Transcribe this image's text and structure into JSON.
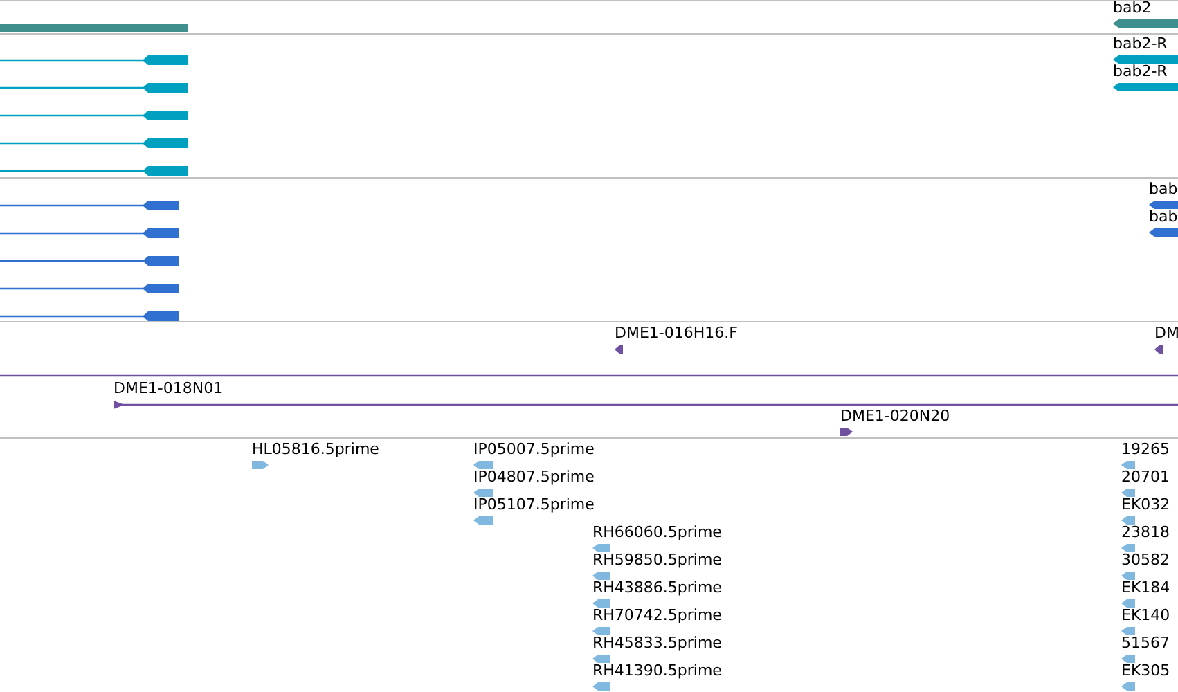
{
  "tracks": [
    {
      "color": "#3f8f8f",
      "features": [
        {
          "kind": "box"
        },
        {
          "kind": "box",
          "label": "bab2",
          "forward": false
        }
      ]
    },
    {
      "color": "#00a0c0",
      "features": [
        {
          "kind": "spliced",
          "forward": false
        },
        {
          "kind": "spliced",
          "forward": false
        },
        {
          "kind": "spliced",
          "forward": false
        },
        {
          "kind": "spliced",
          "forward": false
        },
        {
          "kind": "spliced",
          "forward": false
        },
        {
          "kind": "box",
          "label": "bab2-R",
          "forward": false
        },
        {
          "kind": "box",
          "label": "bab2-R",
          "forward": false
        }
      ]
    },
    {
      "color": "#3070d0",
      "features": [
        {
          "kind": "spliced",
          "forward": false
        },
        {
          "kind": "spliced",
          "forward": false
        },
        {
          "kind": "spliced",
          "forward": false
        },
        {
          "kind": "spliced",
          "forward": false
        },
        {
          "kind": "spliced",
          "forward": false
        },
        {
          "kind": "box",
          "label": "bab",
          "forward": false
        },
        {
          "kind": "box",
          "label": "bab",
          "forward": false
        }
      ]
    },
    {
      "color": "#7050a0",
      "features": [
        {
          "kind": "box",
          "label": "DME1-016H16.F",
          "forward": false
        },
        {
          "kind": "box",
          "label": "DM",
          "forward": false
        },
        {
          "kind": "span"
        },
        {
          "kind": "span",
          "label": "DME1-018N01",
          "forward": true
        },
        {
          "kind": "box",
          "label": "DME1-020N20",
          "forward": true
        }
      ]
    },
    {
      "color": "#80b8e0",
      "features": [
        {
          "kind": "box",
          "label": "HL05816.5prime",
          "forward": true
        },
        {
          "kind": "box",
          "label": "IP05007.5prime",
          "forward": false
        },
        {
          "kind": "box",
          "label": "IP04807.5prime",
          "forward": false
        },
        {
          "kind": "box",
          "label": "IP05107.5prime",
          "forward": false
        },
        {
          "kind": "box",
          "label": "RH66060.5prime",
          "forward": false
        },
        {
          "kind": "box",
          "label": "RH59850.5prime",
          "forward": false
        },
        {
          "kind": "box",
          "label": "RH43886.5prime",
          "forward": false
        },
        {
          "kind": "box",
          "label": "RH70742.5prime",
          "forward": false
        },
        {
          "kind": "box",
          "label": "RH45833.5prime",
          "forward": false
        },
        {
          "kind": "box",
          "label": "RH41390.5prime",
          "forward": false
        },
        {
          "kind": "box",
          "label": "19265",
          "forward": false
        },
        {
          "kind": "box",
          "label": "20701",
          "forward": false
        },
        {
          "kind": "box",
          "label": "EK032",
          "forward": false
        },
        {
          "kind": "box",
          "label": "23818",
          "forward": false
        },
        {
          "kind": "box",
          "label": "30582",
          "forward": false
        },
        {
          "kind": "box",
          "label": "EK184",
          "forward": false
        },
        {
          "kind": "box",
          "label": "EK140",
          "forward": false
        },
        {
          "kind": "box",
          "label": "51567",
          "forward": false
        },
        {
          "kind": "box",
          "label": "EK305",
          "forward": false
        }
      ]
    }
  ]
}
